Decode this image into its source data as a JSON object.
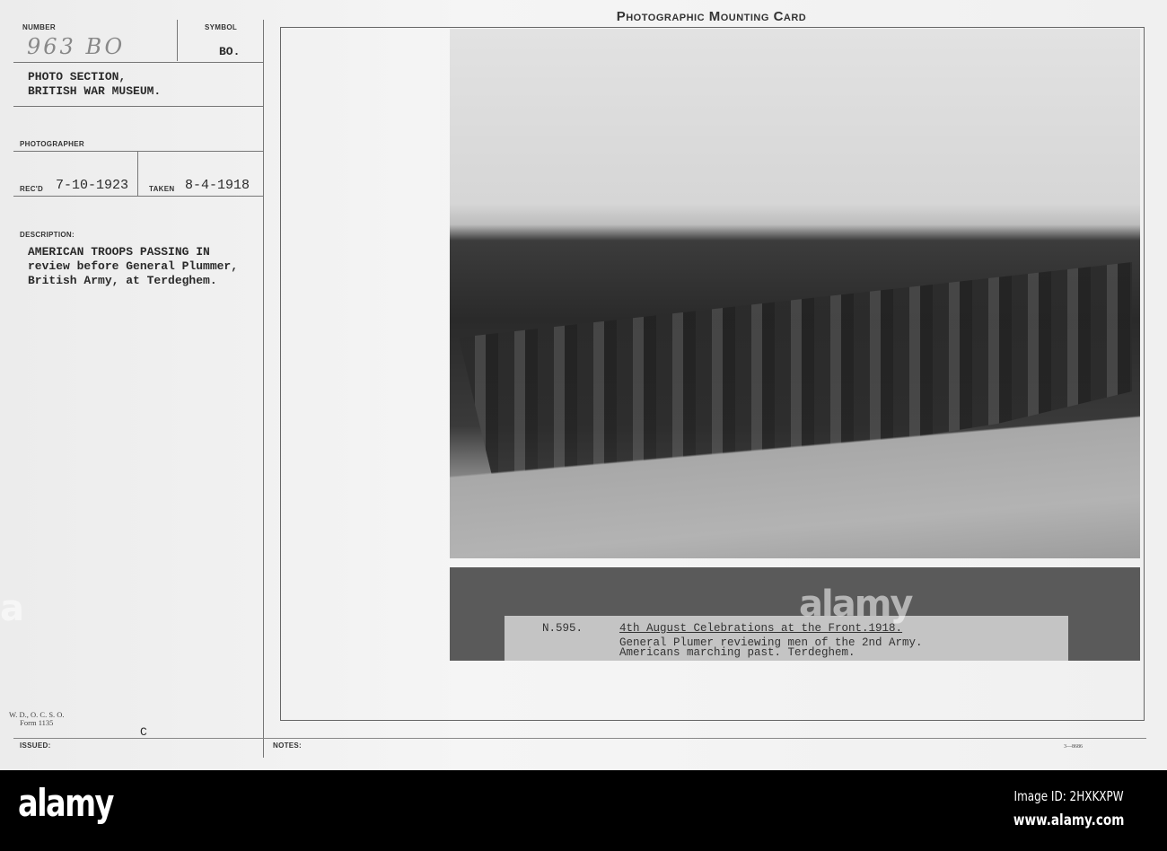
{
  "card_title": "Photographic Mounting Card",
  "left": {
    "number_label": "NUMBER",
    "number_value": "963 BO",
    "symbol_label": "SYMBOL",
    "symbol_value": "BO.",
    "section": "PHOTO SECTION,\nBRITISH WAR MUSEUM.",
    "photographer_label": "PHOTOGRAPHER",
    "recd_label": "REC'D",
    "recd_value": "7-10-1923",
    "taken_label": "TAKEN",
    "taken_value": "8-4-1918",
    "description_label": "DESCRIPTION:",
    "description": "AMERICAN TROOPS PASSING IN\nreview before General Plummer,\nBritish Army, at Terdeghem.",
    "form": "W. D., O. C. S. O.\nForm 1135",
    "c_mark": "C",
    "issued_label": "ISSUED:"
  },
  "notes_label": "NOTES:",
  "form_code": "3—8686",
  "caption": {
    "number": "N.595.",
    "line1": "4th August Celebrations at the Front.1918.",
    "line2": "General Plumer reviewing men of the 2nd Army.",
    "line3": "Americans marching past. Terdeghem."
  },
  "footer": {
    "logo": "alamy",
    "image_id": "Image ID: 2HXKXPW",
    "url": "www.alamy.com"
  }
}
